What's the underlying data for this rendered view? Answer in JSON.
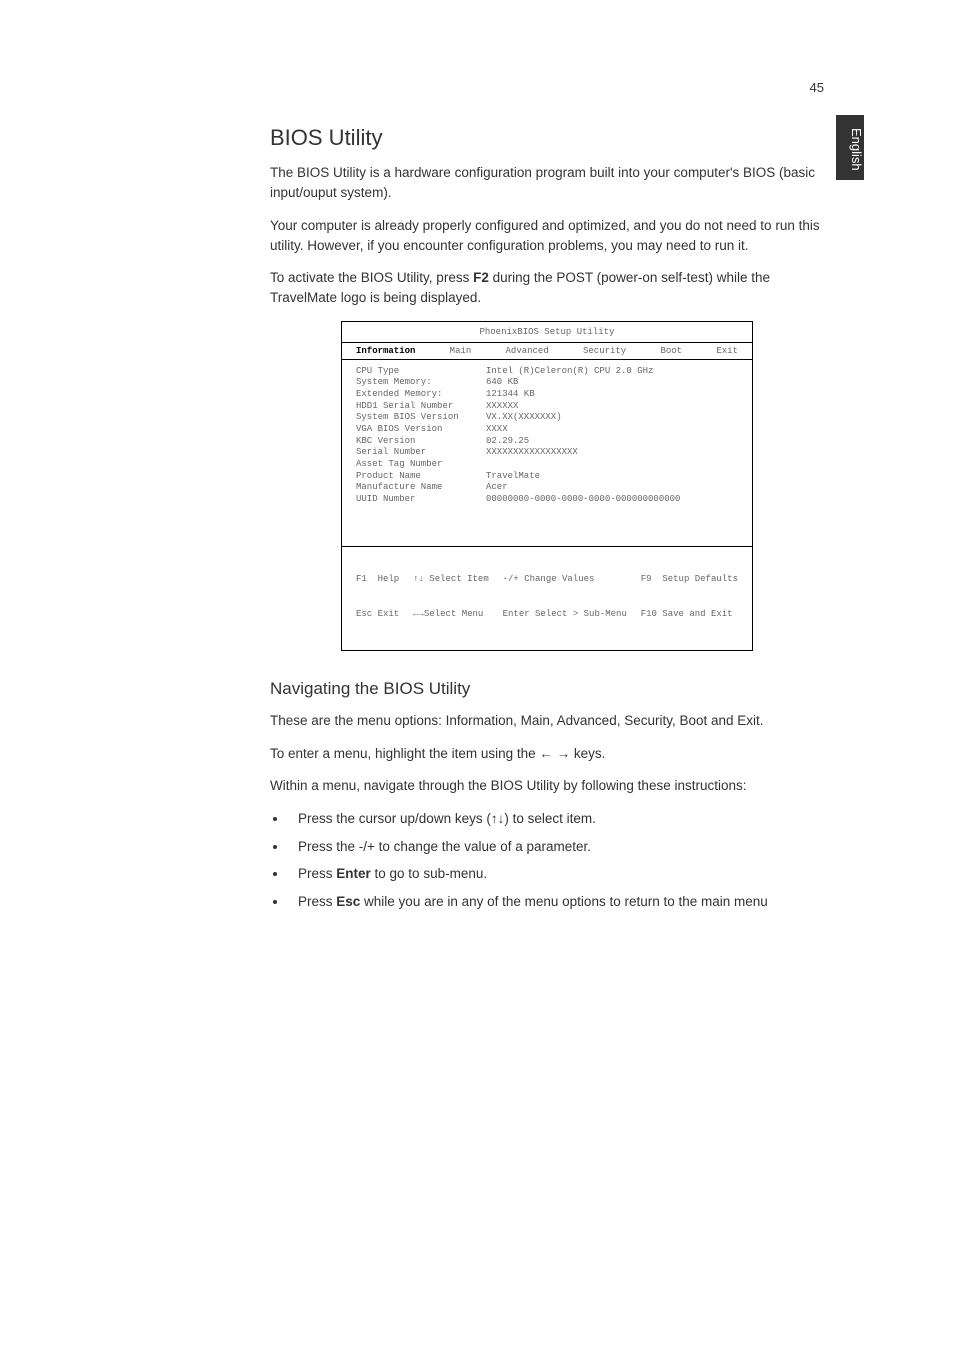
{
  "page_number": "45",
  "side_tab": "English",
  "h1": "BIOS Utility",
  "p1": "The BIOS Utility is a hardware configuration program built into your computer's BIOS (basic input/ouput system).",
  "p2": "Your computer is already properly configured and optimized, and you do not need to run this utility.  However, if you encounter configuration problems, you may need to run it.",
  "p3_a": "To activate the BIOS Utility, press ",
  "p3_b": "F2",
  "p3_c": " during the POST (power-on self-test)  while the TravelMate logo is being displayed.",
  "bios": {
    "title": "PhoenixBIOS Setup Utility",
    "tabs": [
      "Information",
      "Main",
      "Advanced",
      "Security",
      "Boot",
      "Exit"
    ],
    "rows": [
      {
        "label": "CPU Type",
        "value": "Intel (R)Celeron(R) CPU  2.0 GHz"
      },
      {
        "label": "System Memory:",
        "value": "640 KB"
      },
      {
        "label": "Extended Memory:",
        "value": "121344 KB"
      },
      {
        "label": "HDD1 Serial Number",
        "value": "XXXXXX"
      },
      {
        "label": "System BIOS Version",
        "value": "VX.XX(XXXXXXX)"
      },
      {
        "label": "VGA BIOS Version",
        "value": "XXXX"
      },
      {
        "label": "KBC Version",
        "value": "02.29.25"
      },
      {
        "label": "Serial Number",
        "value": "XXXXXXXXXXXXXXXXX"
      },
      {
        "label": "Asset Tag Number",
        "value": ""
      },
      {
        "label": "Product Name",
        "value": "TravelMate"
      },
      {
        "label": "Manufacture Name",
        "value": "Acer"
      },
      {
        "label": "UUID Number",
        "value": "00000000-0000-0000-0000-000000000000"
      }
    ],
    "footer_l1_a": "F1  Help",
    "footer_l1_b": "↑↓ Select Item",
    "footer_l1_c": "-/+ Change Values",
    "footer_l1_d": "F9  Setup Defaults",
    "footer_l2_a": "Esc Exit",
    "footer_l2_b": "←→Select Menu",
    "footer_l2_c": "Enter Select > Sub-Menu",
    "footer_l2_d": "F10 Save and Exit"
  },
  "h2": "Navigating the BIOS Utility",
  "p4": "These are the menu options: Information, Main, Advanced, Security, Boot and Exit.",
  "p5": "To enter a menu, highlight the item using the ← → keys.",
  "p6": "Within a menu, navigate through the BIOS Utility by following these instructions:",
  "bullets": {
    "b1": "Press the cursor up/down keys (↑↓) to select item.",
    "b2": "Press the -/+ to change the value of a parameter.",
    "b3a": "Press ",
    "b3b": "Enter",
    "b3c": " to go to sub-menu.",
    "b4a": "Press ",
    "b4b": "Esc",
    "b4c": " while you are in any of the menu options to return to the main menu"
  }
}
